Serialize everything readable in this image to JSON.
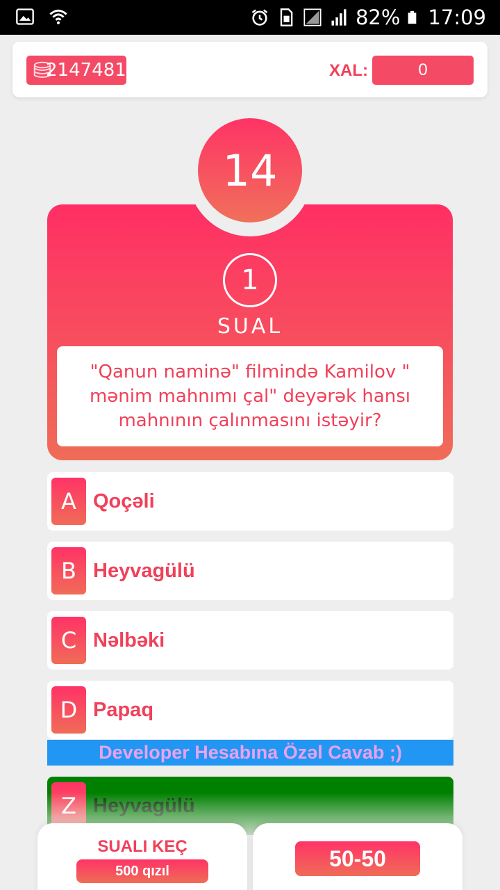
{
  "status_bar": {
    "icons_left": [
      "image-icon",
      "wifi-icon"
    ],
    "icons_right": [
      "alarm-icon",
      "sim-icon",
      "signal-icon",
      "signal-icon",
      "battery-icon"
    ],
    "battery": "82%",
    "time": "17:09"
  },
  "header": {
    "coins_value": "2147481",
    "score_label": "XAL:",
    "score_value": "0"
  },
  "timer": "14",
  "question": {
    "number": "1",
    "label": "SUAL",
    "text": "\"Qanun naminə\" filmində Kamilov \" mənim mahnımı çal\" deyərək hansı mahnının çalınmasını istəyir?"
  },
  "answers": [
    {
      "letter": "A",
      "text": "Qoçəli"
    },
    {
      "letter": "B",
      "text": "Heyvagülü"
    },
    {
      "letter": "C",
      "text": "Nəlbəki"
    },
    {
      "letter": "D",
      "text": "Papaq"
    }
  ],
  "developer_banner": "Developer Hesabına Özəl Cavab ;)",
  "developer_answer": {
    "letter": "Z",
    "text": "Heyvagülü"
  },
  "bottom": {
    "skip_label": "SUALI KEÇ",
    "skip_cost": "500 qızıl",
    "fifty_label": "50-50"
  },
  "colors": {
    "accent": "#f44a66",
    "gradient_top": "#ff2e64",
    "gradient_bottom": "#f06c58",
    "banner_blue": "#2196f3",
    "developer_green": "#008000"
  }
}
